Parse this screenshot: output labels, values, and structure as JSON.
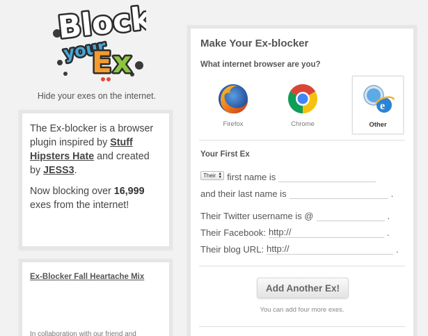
{
  "logo": {
    "line1": "Block",
    "line2": "your",
    "line3": "Ex"
  },
  "tagline": "Hide your exes on the internet.",
  "intro": {
    "p1_a": "The Ex-blocker is a browser plugin inspired by ",
    "p1_link1": "Stuff Hipsters Hate",
    "p1_b": " and created by ",
    "p1_link2": "JESS3",
    "p1_c": ".",
    "p2_a": "Now blocking over ",
    "p2_count": "16,999",
    "p2_b": " exes from the internet!"
  },
  "mix": {
    "title": "Ex-Blocker Fall Heartache Mix",
    "text": "In collaboration with our friend and"
  },
  "panel": {
    "title": "Make Your Ex-blocker",
    "question": "What internet browser are you?",
    "browsers": [
      {
        "label": "Firefox",
        "icon": "firefox-icon",
        "selected": false
      },
      {
        "label": "Chrome",
        "icon": "chrome-icon",
        "selected": false
      },
      {
        "label": "Other",
        "icon": "safari-ie-icon",
        "selected": true
      }
    ],
    "section": "Your First Ex",
    "form": {
      "pronoun_select": "Their",
      "first_label": "first name is",
      "last_label": "and their last name is",
      "twitter_label": "Their Twitter username is @",
      "facebook_label": "Their Facebook:",
      "facebook_value": "http://",
      "blog_label": "Their blog URL:",
      "blog_value": "http://",
      "period": "."
    },
    "add_button": "Add Another Ex!",
    "add_note": "You can add four more exes."
  }
}
